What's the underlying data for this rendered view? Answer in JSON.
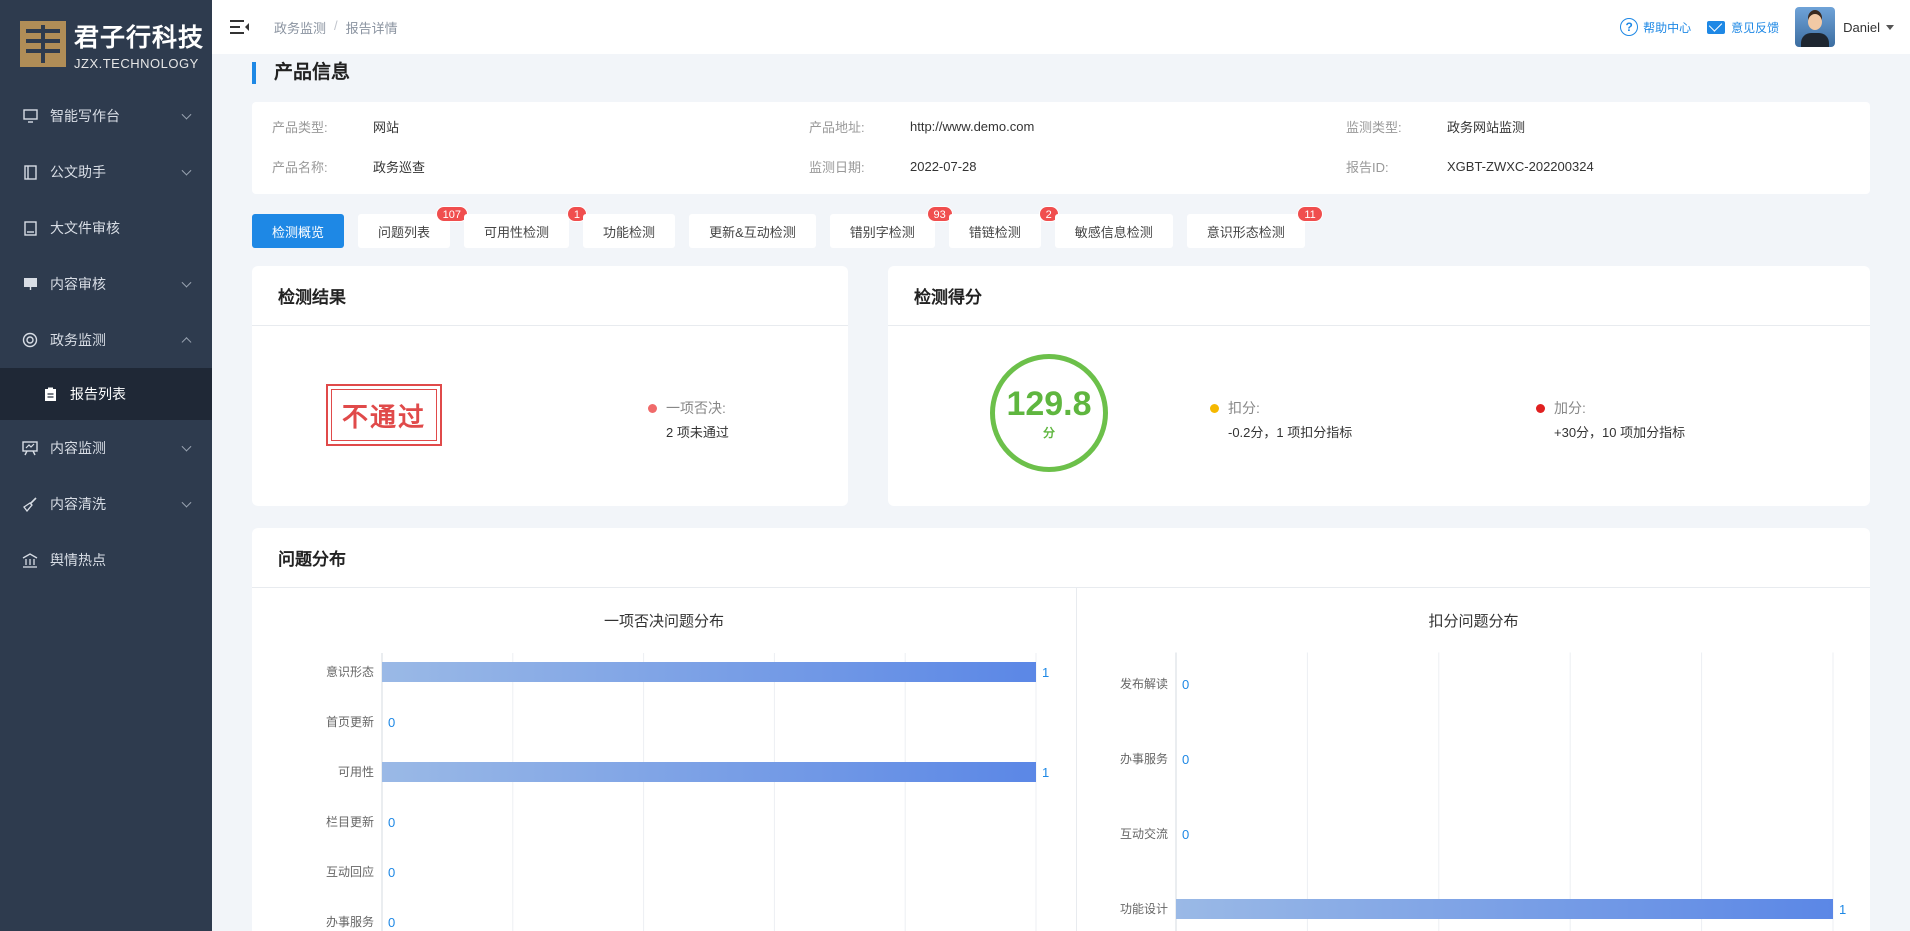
{
  "brand": {
    "name_cn": "君子行科技",
    "name_en": "JZX.TECHNOLOGY"
  },
  "sidebar": {
    "items": [
      {
        "label": "智能写作台",
        "icon": "monitor-icon"
      },
      {
        "label": "公文助手",
        "icon": "notebook-icon"
      },
      {
        "label": "大文件审核",
        "icon": "file-icon"
      },
      {
        "label": "内容审核",
        "icon": "screen-icon"
      },
      {
        "label": "政务监测",
        "icon": "lifebuoy-icon"
      },
      {
        "label": "报告列表",
        "icon": "clipboard-icon"
      },
      {
        "label": "内容监测",
        "icon": "presentation-icon"
      },
      {
        "label": "内容清洗",
        "icon": "broom-icon"
      },
      {
        "label": "舆情热点",
        "icon": "building-icon"
      }
    ]
  },
  "header": {
    "breadcrumb": [
      "政务监测",
      "报告详情"
    ],
    "help_label": "帮助中心",
    "feedback_label": "意见反馈",
    "username": "Daniel"
  },
  "product": {
    "section_title": "产品信息",
    "fields": [
      {
        "label": "产品类型:",
        "value": "网站"
      },
      {
        "label": "产品地址:",
        "value": "http://www.demo.com"
      },
      {
        "label": "监测类型:",
        "value": "政务网站监测"
      },
      {
        "label": "产品名称:",
        "value": "政务巡查"
      },
      {
        "label": "监测日期:",
        "value": "2022-07-28"
      },
      {
        "label": "报告ID:",
        "value": "XGBT-ZWXC-202200324"
      }
    ]
  },
  "tabs": [
    {
      "label": "检测概览",
      "badge": ""
    },
    {
      "label": "问题列表",
      "badge": "107"
    },
    {
      "label": "可用性检测",
      "badge": "1"
    },
    {
      "label": "功能检测",
      "badge": ""
    },
    {
      "label": "更新&互动检测",
      "badge": ""
    },
    {
      "label": "错别字检测",
      "badge": "93"
    },
    {
      "label": "错链检测",
      "badge": "2"
    },
    {
      "label": "敏感信息检测",
      "badge": ""
    },
    {
      "label": "意识形态检测",
      "badge": "11"
    }
  ],
  "result": {
    "title": "检测结果",
    "stamp": "不通过",
    "veto_title": "一项否决:",
    "veto_desc": "2 项未通过",
    "veto_color": "#f06a6a"
  },
  "score": {
    "title": "检测得分",
    "value": "129.8",
    "unit": "分",
    "deduct_title": "扣分:",
    "deduct_desc": "-0.2分，1 项扣分指标",
    "deduct_color": "#f5b800",
    "bonus_title": "加分:",
    "bonus_desc": "+30分，10 项加分指标",
    "bonus_color": "#e02020"
  },
  "distribution": {
    "title": "问题分布"
  },
  "chart_data": [
    {
      "type": "bar",
      "orientation": "horizontal",
      "title": "一项否决问题分布",
      "categories": [
        "意识形态",
        "首页更新",
        "可用性",
        "栏目更新",
        "互动回应",
        "办事服务"
      ],
      "values": [
        1,
        0,
        1,
        0,
        0,
        0
      ],
      "xlim": [
        0,
        1
      ],
      "grid": true,
      "bar_color_start": "#9ab9e6",
      "bar_color_end": "#5b87e6",
      "label_color": "#1e88e5"
    },
    {
      "type": "bar",
      "orientation": "horizontal",
      "title": "扣分问题分布",
      "categories": [
        "发布解读",
        "办事服务",
        "互动交流",
        "功能设计"
      ],
      "values": [
        0,
        0,
        0,
        1
      ],
      "xlim": [
        0,
        1
      ],
      "grid": true,
      "bar_color_start": "#9ab9e6",
      "bar_color_end": "#5b87e6",
      "label_color": "#1e88e5"
    }
  ]
}
